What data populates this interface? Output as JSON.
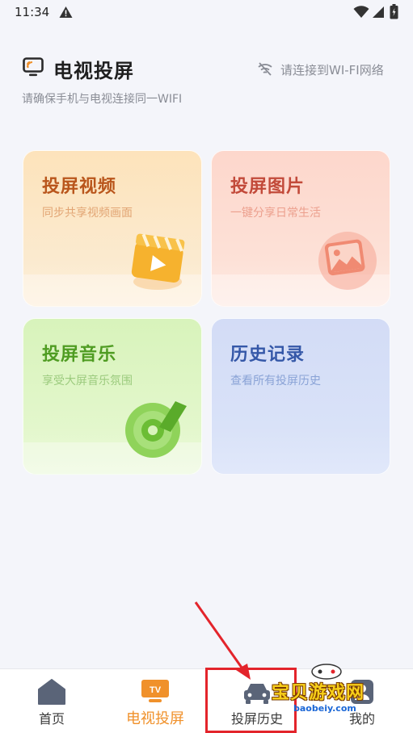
{
  "status_bar": {
    "time": "11:34",
    "icons": [
      "warning-icon",
      "wifi-icon",
      "signal-icon",
      "battery-icon"
    ]
  },
  "header": {
    "title": "电视投屏",
    "subtitle": "请确保手机与电视连接同一WIFI",
    "wifi_status": "请连接到WI-FI网络",
    "icons": [
      "tv-logo-icon",
      "wifi-off-icon"
    ]
  },
  "cards": [
    {
      "title": "投屏视频",
      "desc": "同步共享视频画面",
      "icon": "film-clapper-icon",
      "color": "#b9561c"
    },
    {
      "title": "投屏图片",
      "desc": "一键分享日常生活",
      "icon": "picture-icon",
      "color": "#c24a3a"
    },
    {
      "title": "投屏音乐",
      "desc": "享受大屏音乐氛围",
      "icon": "music-disc-icon",
      "color": "#4f9c22"
    },
    {
      "title": "历史记录",
      "desc": "查看所有投屏历史",
      "icon": "",
      "color": "#3558a8"
    }
  ],
  "bottom_nav": {
    "items": [
      {
        "label": "首页",
        "icon": "home-icon",
        "active": false
      },
      {
        "label": "电视投屏",
        "icon": "tv-icon",
        "active": true,
        "badge": "TV"
      },
      {
        "label": "投屏历史",
        "icon": "car-icon",
        "active": false
      },
      {
        "label": "我的",
        "icon": "profile-icon",
        "active": false
      }
    ],
    "active_color": "#f0912b"
  },
  "watermark": {
    "text": "宝贝游戏网",
    "url": "baobeiy.com"
  }
}
